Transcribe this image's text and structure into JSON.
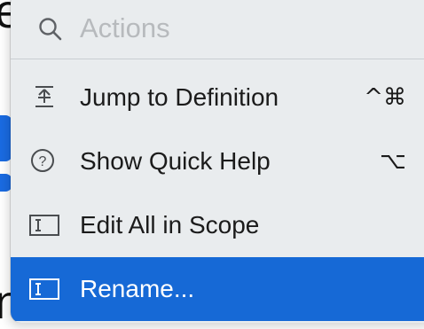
{
  "search": {
    "placeholder": "Actions",
    "icon": "search-icon"
  },
  "background": {
    "top_char": "e",
    "bottom_char": "n"
  },
  "items": [
    {
      "label": "Jump to Definition",
      "shortcut": "^⌘",
      "icon": "jump-to-definition-icon",
      "selected": false
    },
    {
      "label": "Show Quick Help",
      "shortcut": "⌥",
      "icon": "question-circle-icon",
      "selected": false
    },
    {
      "label": "Edit All in Scope",
      "shortcut": "",
      "icon": "text-cursor-box-icon",
      "selected": false
    },
    {
      "label": "Rename...",
      "shortcut": "",
      "icon": "text-cursor-box-icon",
      "selected": true
    }
  ],
  "colors": {
    "menu_background": "#e9ecee",
    "selection": "#1669d6",
    "editor_highlight": "#1a6be2"
  }
}
